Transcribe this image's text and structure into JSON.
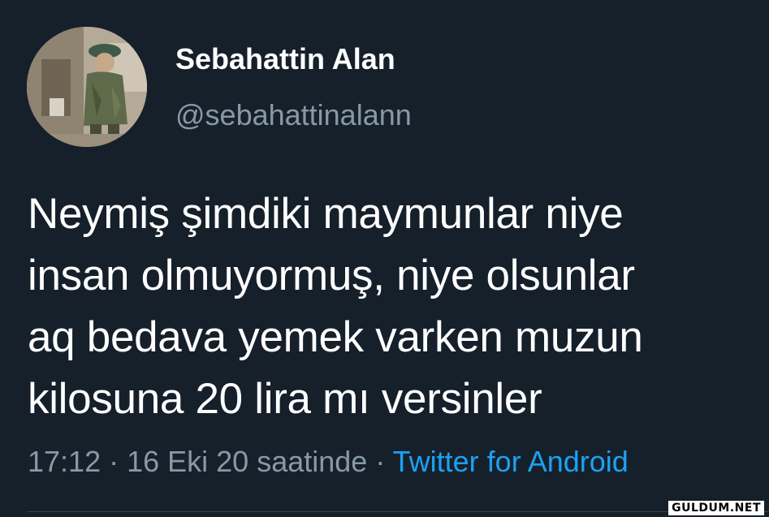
{
  "user": {
    "display_name": "Sebahattin Alan",
    "handle": "@sebahattinalann",
    "avatar_icon": "user-avatar-photo"
  },
  "tweet": {
    "lines": [
      "Neymiş şimdiki maymunlar niye",
      "insan olmuyormuş, niye olsunlar",
      "aq bedava yemek varken muzun",
      "kilosuna 20 lira mı versinler"
    ]
  },
  "meta": {
    "time": "17:12",
    "separator": " · ",
    "date": "16 Eki 20 saatinde",
    "source": "Twitter for Android"
  },
  "watermark": "GULDUM.NET",
  "colors": {
    "background": "#15202b",
    "primary_text": "#ffffff",
    "secondary_text": "#8899a6",
    "link": "#1da1f2",
    "divider": "#38444d"
  }
}
